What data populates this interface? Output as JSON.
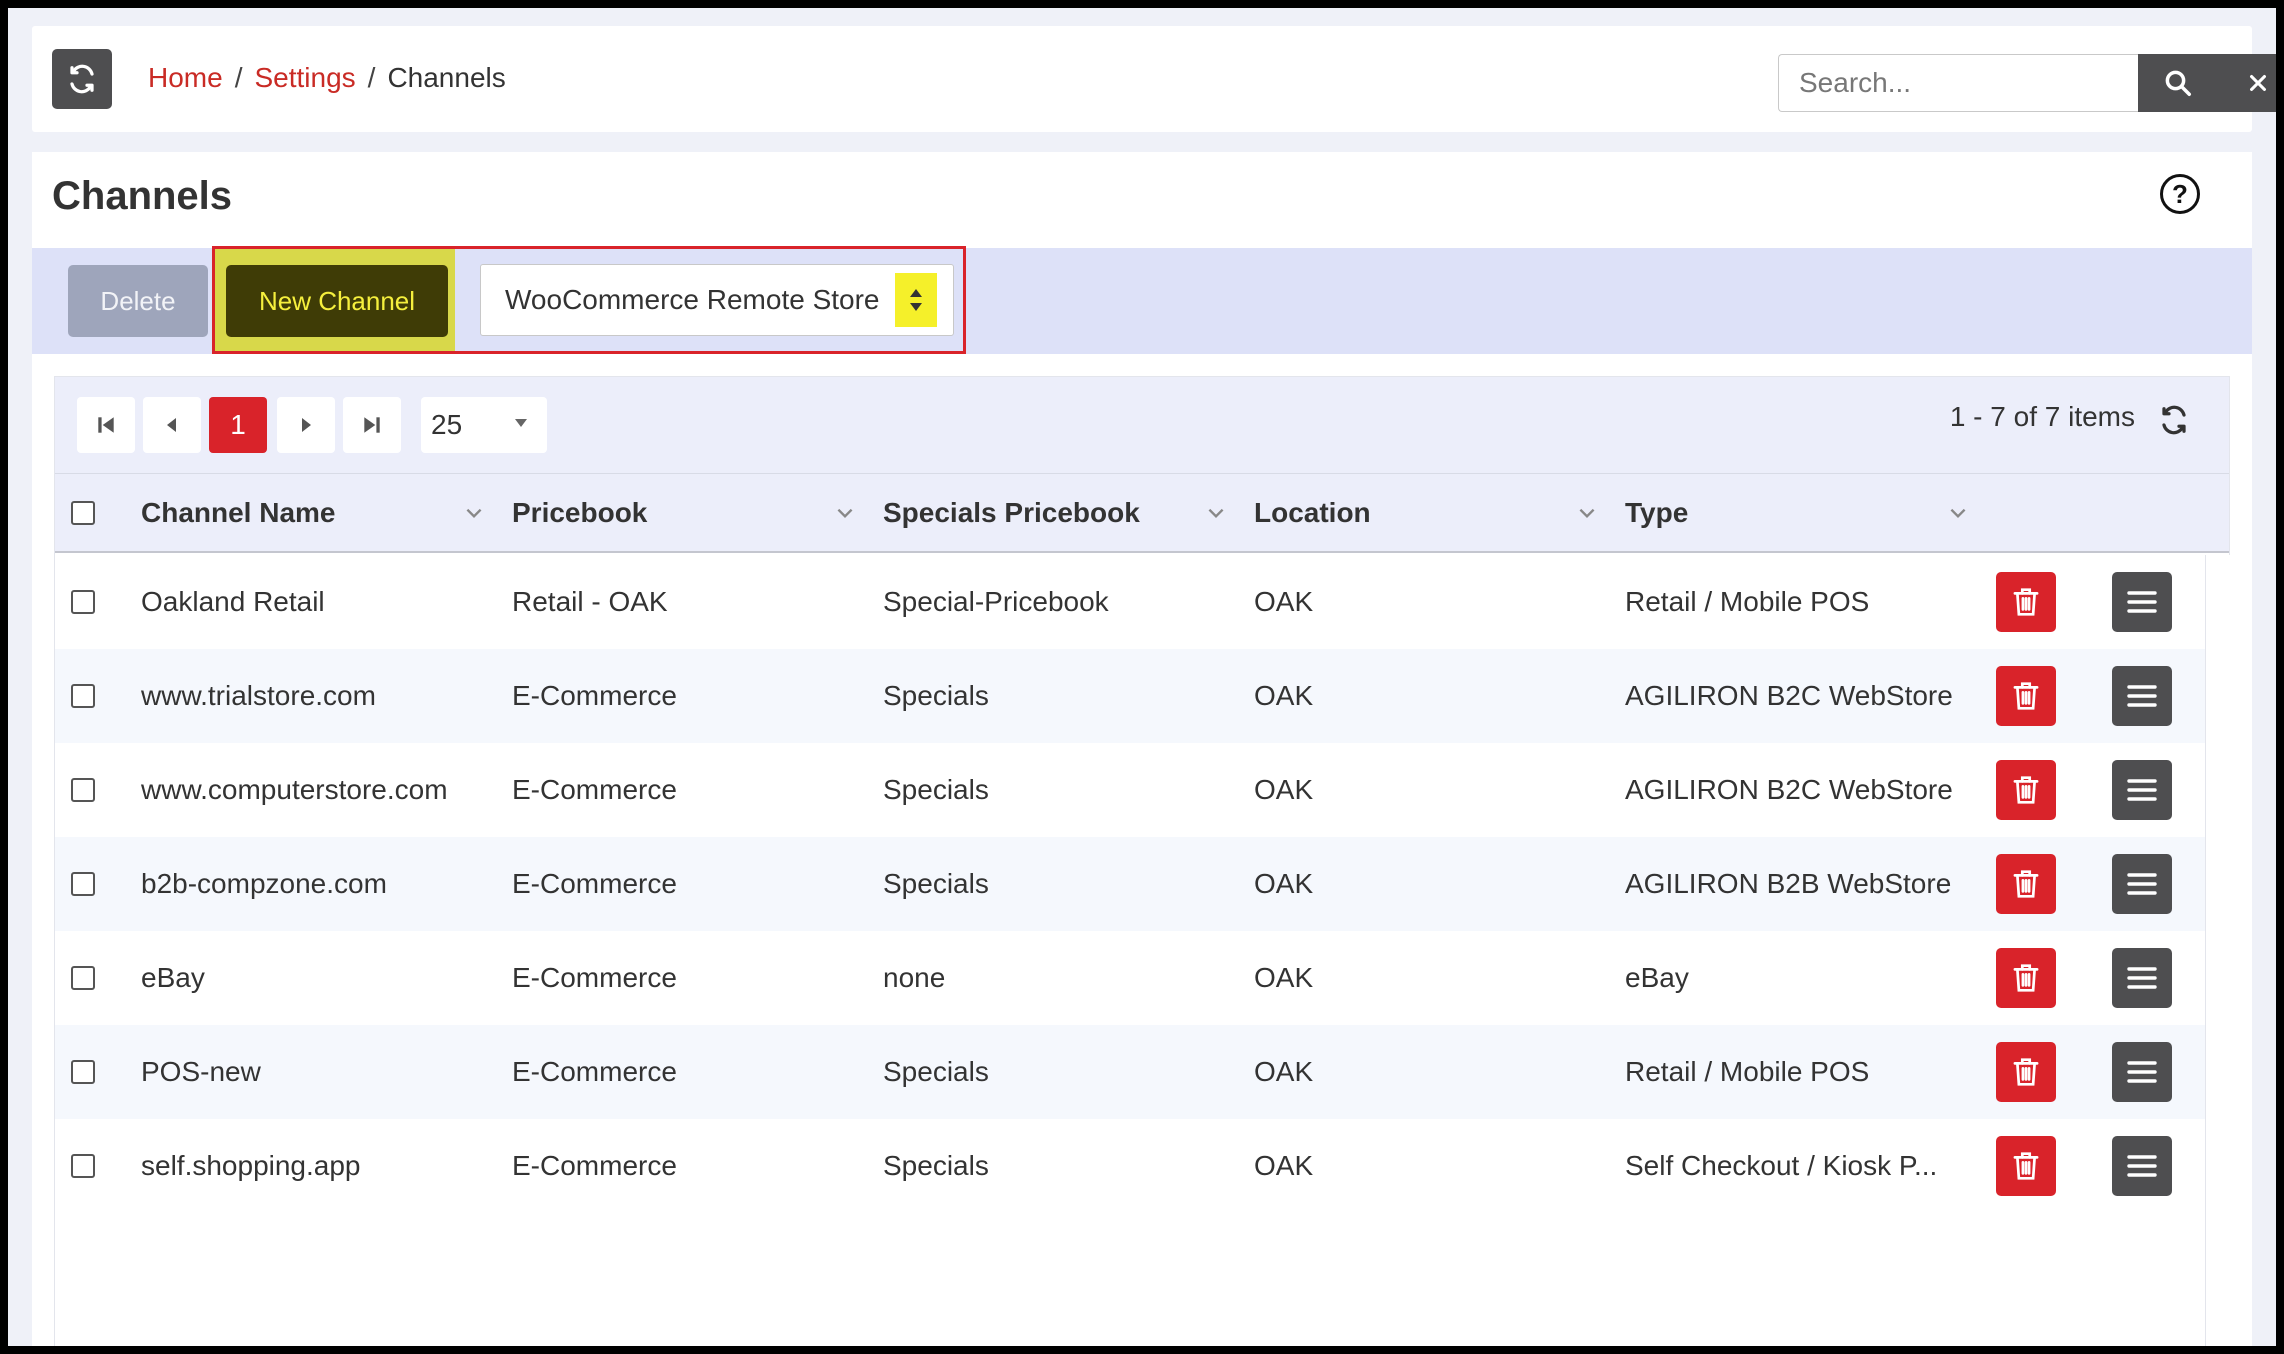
{
  "breadcrumb": {
    "home": "Home",
    "settings": "Settings",
    "current": "Channels",
    "sep": "/"
  },
  "search": {
    "placeholder": "Search..."
  },
  "page": {
    "title": "Channels",
    "help": "?"
  },
  "toolbar": {
    "delete_label": "Delete",
    "new_label": "New Channel",
    "channel_type_selected": "WooCommerce Remote Store"
  },
  "pager": {
    "current_page": "1",
    "page_size": "25",
    "info": "1 - 7 of 7 items"
  },
  "columns": [
    "Channel Name",
    "Pricebook",
    "Specials Pricebook",
    "Location",
    "Type"
  ],
  "rows": [
    {
      "name": "Oakland Retail",
      "pricebook": "Retail - OAK",
      "specials": "Special-Pricebook",
      "location": "OAK",
      "type": "Retail / Mobile POS"
    },
    {
      "name": "www.trialstore.com",
      "pricebook": "E-Commerce",
      "specials": "Specials",
      "location": "OAK",
      "type": "AGILIRON B2C WebStore"
    },
    {
      "name": "www.computerstore.com",
      "pricebook": "E-Commerce",
      "specials": "Specials",
      "location": "OAK",
      "type": "AGILIRON B2C WebStore"
    },
    {
      "name": "b2b-compzone.com",
      "pricebook": "E-Commerce",
      "specials": "Specials",
      "location": "OAK",
      "type": "AGILIRON B2B WebStore"
    },
    {
      "name": "eBay",
      "pricebook": "E-Commerce",
      "specials": "none",
      "location": "OAK",
      "type": "eBay"
    },
    {
      "name": "POS-new",
      "pricebook": "E-Commerce",
      "specials": "Specials",
      "location": "OAK",
      "type": "Retail / Mobile POS"
    },
    {
      "name": "self.shopping.app",
      "pricebook": "E-Commerce",
      "specials": "Specials",
      "location": "OAK",
      "type": "Self Checkout / Kiosk P..."
    }
  ],
  "icons": {
    "refresh": "refresh-icon",
    "search": "search-icon",
    "clear": "close-icon",
    "help": "help-icon",
    "row_delete": "trash-icon",
    "row_menu": "menu-icon"
  },
  "colors": {
    "accent_red": "#d9232a",
    "dark_button": "#4e4e50",
    "highlight_yellow": "#f5f02a",
    "toolbar_bg": "#dde1f8"
  }
}
